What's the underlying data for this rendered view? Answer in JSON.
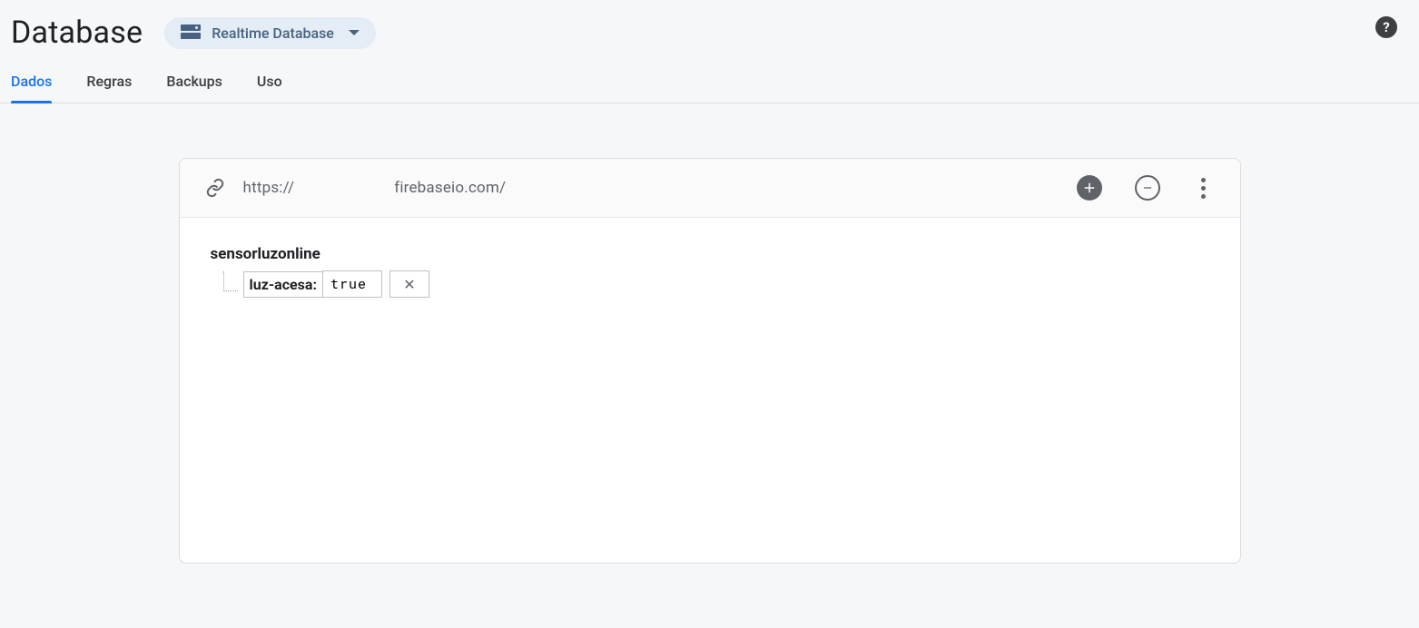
{
  "header": {
    "title": "Database",
    "selector_label": "Realtime Database"
  },
  "tabs": [
    {
      "label": "Dados",
      "active": true
    },
    {
      "label": "Regras",
      "active": false
    },
    {
      "label": "Backups",
      "active": false
    },
    {
      "label": "Uso",
      "active": false
    }
  ],
  "url": {
    "prefix": "https://",
    "suffix": "firebaseio.com/"
  },
  "tree": {
    "root": "sensorluzonline",
    "child_key": "luz-acesa:",
    "child_value": "true"
  },
  "icons": {
    "help": "?",
    "add": "+",
    "remove": "−",
    "close": "✕"
  }
}
